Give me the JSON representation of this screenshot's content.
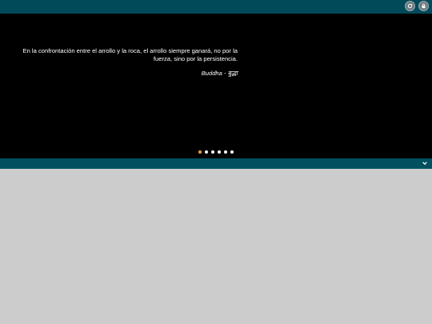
{
  "header": {
    "icons": [
      {
        "name": "refresh-icon"
      },
      {
        "name": "lock-icon"
      }
    ]
  },
  "slider": {
    "quote": "En la confrontación entre el arrollo y la roca, el arrollo siempre ganará, no por la fuerza, sino por la persistencia.",
    "author": "Buddha - बुद्धा",
    "dots_count": 6,
    "active_index": 0
  },
  "colors": {
    "bar": "#004a5a",
    "active_dot": "#e8a33a",
    "background": "#cccccc"
  },
  "bottombar": {
    "icon": "chevron-down-icon"
  }
}
